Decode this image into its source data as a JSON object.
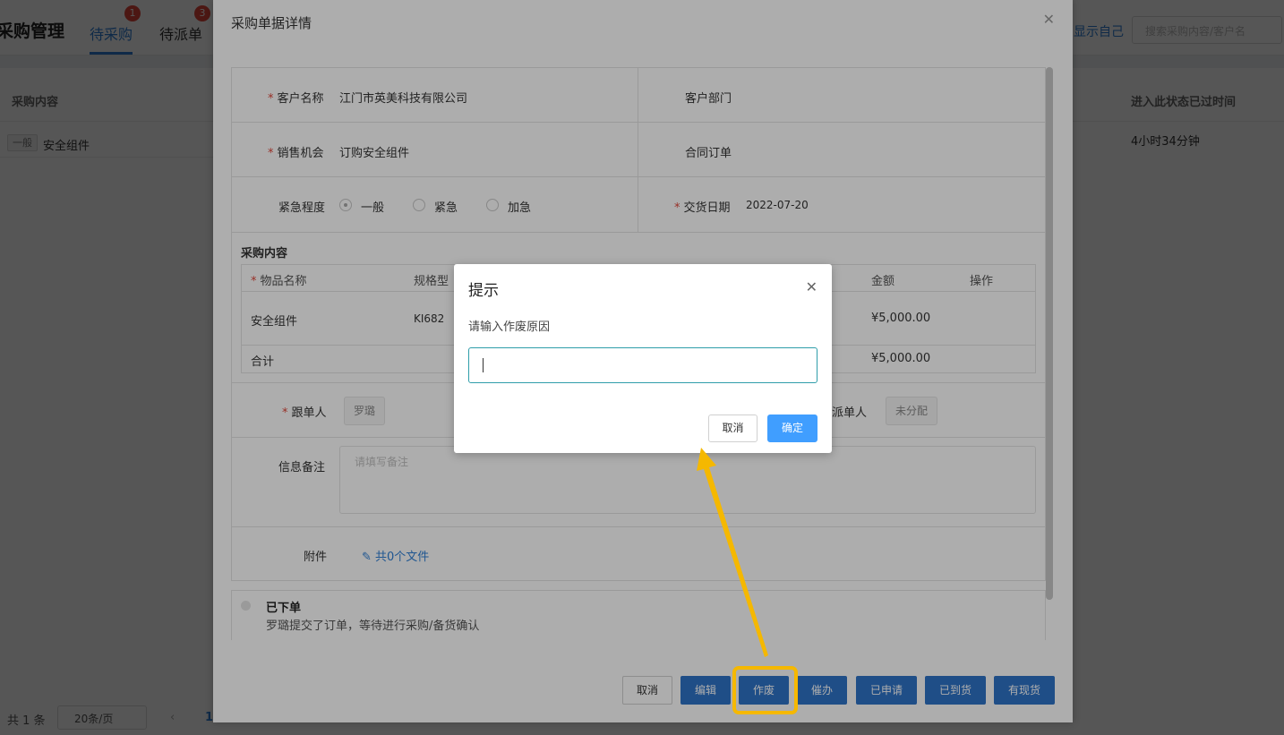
{
  "background": {
    "title": "采购管理",
    "tabs": [
      {
        "label": "待采购",
        "badge": "1"
      },
      {
        "label": "待派单",
        "badge": "3"
      }
    ],
    "show_self_link": "显示自己",
    "search_placeholder": "搜索采购内容/客户名",
    "columns": [
      "采购内容",
      "进入此状态已过时间"
    ],
    "row": {
      "tag": "一般",
      "content": "安全组件",
      "elapsed": "4小时34分钟"
    },
    "footer": {
      "total": "共 1 条",
      "page_size": "20条/页",
      "page": "1"
    }
  },
  "drawer": {
    "title": "采购单据详情",
    "close_icon": "close-icon",
    "fields": {
      "customer_label": "客户名称",
      "customer_value": "江门市英美科技有限公司",
      "dept_label": "客户部门",
      "opportunity_label": "销售机会",
      "opportunity_value": "订购安全组件",
      "contract_label": "合同订单",
      "urgency_label": "紧急程度",
      "urgency_options": [
        "一般",
        "紧急",
        "加急"
      ],
      "urgency_selected": "一般",
      "delivery_label": "交货日期",
      "delivery_value": "2022-07-20",
      "follower_label": "跟单人",
      "follower_value": "罗璐",
      "dispatcher_label": "派单人",
      "dispatcher_value": "未分配",
      "note_label": "信息备注",
      "note_placeholder": "请填写备注",
      "attach_label": "附件",
      "attach_link": "共0个文件"
    },
    "purchase_section": "采购内容",
    "table": {
      "headers": [
        "物品名称",
        "规格型",
        "金额",
        "操作"
      ],
      "rows": [
        {
          "name": "安全组件",
          "spec": "KI682",
          "amount": "¥5,000.00"
        }
      ],
      "total_label": "合计",
      "total_amount": "¥5,000.00"
    },
    "timeline": {
      "status": "已下单",
      "desc": "罗璐提交了订单，等待进行采购/备货确认"
    },
    "buttons": [
      "取消",
      "编辑",
      "作废",
      "催办",
      "已申请",
      "已到货",
      "有现货"
    ]
  },
  "dialog": {
    "title": "提示",
    "message": "请输入作废原因",
    "input_value": "",
    "cancel": "取消",
    "ok": "确定"
  },
  "colors": {
    "primary": "#2f74c8",
    "dialog_ok": "#409eff",
    "highlight": "#f5b800"
  }
}
